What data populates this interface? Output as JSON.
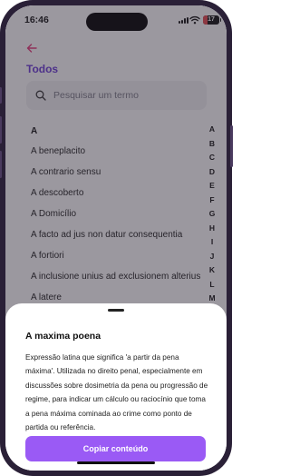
{
  "status_bar": {
    "time": "16:46",
    "battery_level": "17",
    "battery_color": "#e5484d",
    "icons": [
      "signal-icon",
      "wifi-icon",
      "battery-icon"
    ]
  },
  "header": {
    "back_icon": "arrow-left-icon",
    "title": "Todos",
    "accent_color": "#6a3bd6"
  },
  "search": {
    "placeholder": "Pesquisar um termo",
    "value": "",
    "icon": "search-icon"
  },
  "list": {
    "section": "A",
    "terms": [
      "A beneplacito",
      "A contrario sensu",
      "A descoberto",
      "A Domicílio",
      "A facto ad jus non datur consequentia",
      "A fortiori",
      "A inclusione unius ad exclusionem alterius",
      "A latere"
    ]
  },
  "alphabet_index": [
    "A",
    "B",
    "C",
    "D",
    "E",
    "F",
    "G",
    "H",
    "I",
    "J",
    "K",
    "L",
    "M"
  ],
  "sheet": {
    "title": "A maxima poena",
    "body": "Expressão latina que significa 'a partir da pena máxima'. Utilizada no direito penal, especialmente em discussões sobre dosimetria da pena ou progressão de regime, para indicar um cálculo ou raciocínio que toma a pena máxima cominada ao crime como ponto de partida ou referência.",
    "button_label": "Copiar conteúdo",
    "button_color": "#9a5af5"
  }
}
